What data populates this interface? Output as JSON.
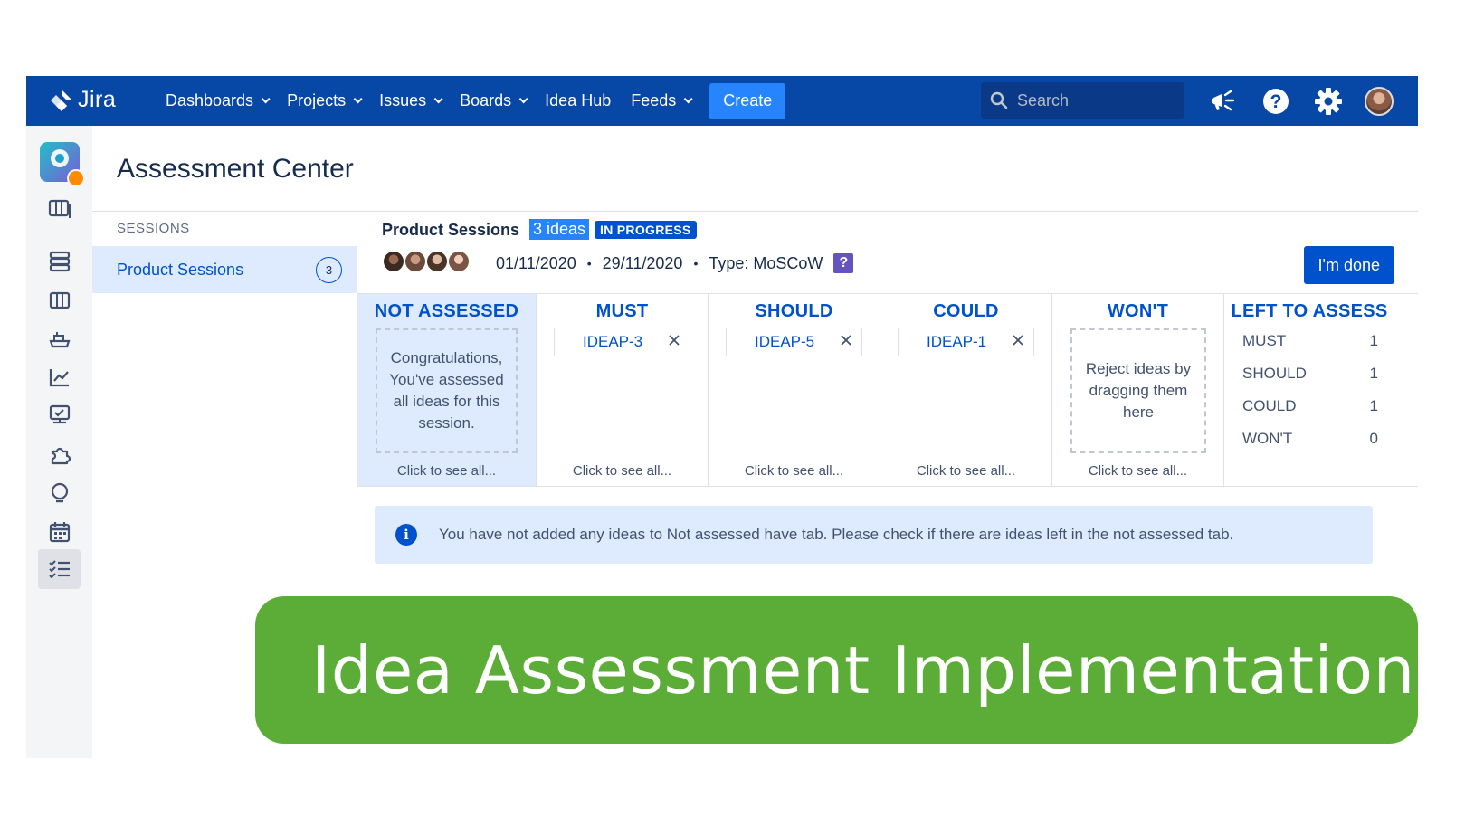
{
  "app": {
    "name": "Jira"
  },
  "nav": {
    "items": [
      {
        "label": "Dashboards",
        "dropdown": true
      },
      {
        "label": "Projects",
        "dropdown": true
      },
      {
        "label": "Issues",
        "dropdown": true
      },
      {
        "label": "Boards",
        "dropdown": true
      },
      {
        "label": "Idea Hub",
        "dropdown": false
      },
      {
        "label": "Feeds",
        "dropdown": true
      }
    ],
    "create_label": "Create",
    "search_placeholder": "Search",
    "icons": [
      "megaphone-icon",
      "help-icon",
      "settings-icon",
      "user-avatar"
    ]
  },
  "sidebar": {
    "icons": [
      "board-icon",
      "backlog-icon",
      "columns-icon",
      "releases-icon",
      "reports-icon",
      "presentation-icon",
      "puzzle-icon",
      "lightbulb-icon",
      "calendar-icon",
      "checklist-icon"
    ],
    "active": "checklist-icon"
  },
  "page": {
    "title": "Assessment Center"
  },
  "sessions": {
    "heading": "SESSIONS",
    "items": [
      {
        "label": "Product Sessions",
        "count": "3"
      }
    ]
  },
  "session": {
    "title": "Product Sessions",
    "ideas_chip": "3 ideas",
    "status": "IN PROGRESS",
    "start_date": "01/11/2020",
    "end_date": "29/11/2020",
    "type": "Type: MoSCoW",
    "help": "?",
    "done_label": "I'm done"
  },
  "board": {
    "see_all": "Click to see all...",
    "columns": [
      {
        "title": "NOT ASSESSED",
        "empty_text": "Congratulations, You've assessed all ideas for this session."
      },
      {
        "title": "MUST",
        "card": "IDEAP-3"
      },
      {
        "title": "SHOULD",
        "card": "IDEAP-5"
      },
      {
        "title": "COULD",
        "card": "IDEAP-1"
      },
      {
        "title": "WON'T",
        "empty_text": "Reject ideas by dragging them here"
      }
    ],
    "summary": {
      "title": "LEFT TO ASSESS",
      "rows": [
        {
          "label": "MUST",
          "value": "1"
        },
        {
          "label": "SHOULD",
          "value": "1"
        },
        {
          "label": "COULD",
          "value": "1"
        },
        {
          "label": "WON'T",
          "value": "0"
        }
      ]
    }
  },
  "info": {
    "icon": "i",
    "message": "You have not added any ideas to Not assessed have tab. Please check if there are ideas left in the not assessed tab."
  },
  "overlay": {
    "text": "Idea Assessment Implementation"
  },
  "colors": {
    "nav": "#0747a6",
    "accent": "#0052cc",
    "create": "#2684ff",
    "overlay": "#5cad37"
  }
}
